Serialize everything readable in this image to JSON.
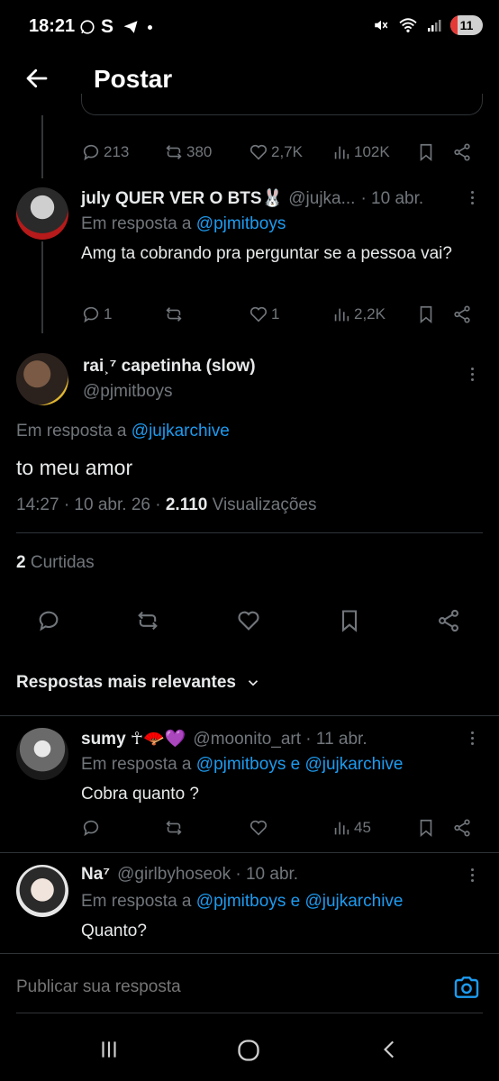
{
  "status_bar": {
    "time": "18:21",
    "app_icons": "S",
    "battery": "11"
  },
  "header": {
    "title": "Postar"
  },
  "parent_actions": {
    "replies": "213",
    "reposts": "380",
    "likes": "2,7K",
    "views": "102K"
  },
  "reply_july": {
    "name": "july QUER VER O BTS🐰",
    "handle": "@jujka...",
    "date": "· 10 abr.",
    "reply_prefix": "Em resposta a",
    "reply_to": "@pjmitboys",
    "text": "Amg ta cobrando pra perguntar se a pessoa vai?",
    "replies": "1",
    "likes": "1",
    "views": "2,2K"
  },
  "main_tweet": {
    "name": "rai˲⁷ capetinha (slow)",
    "handle": "@pjmitboys",
    "reply_prefix": "Em resposta a",
    "reply_to": "@jujkarchive",
    "text": "to meu amor",
    "time": "14:27 · 10 abr. 26 ·",
    "views_count": "2.110",
    "views_label": "Visualizações",
    "likes_count": "2",
    "likes_label": "Curtidas"
  },
  "sort": {
    "label": "Respostas mais relevantes"
  },
  "reply_sumy": {
    "name": "sumy ☥🪭💜",
    "handle_date": "@moonito_art · 11 abr.",
    "reply_prefix": "Em resposta a",
    "reply_to": "@pjmitboys e @jujkarchive",
    "text": "Cobra quanto ?",
    "views": "45"
  },
  "reply_na": {
    "name": "Na⁷",
    "handle_date": "@girlbyhoseok · 10 abr.",
    "reply_prefix": "Em resposta a",
    "reply_to": "@pjmitboys e @jujkarchive",
    "text": "Quanto?"
  },
  "composer": {
    "placeholder": "Publicar sua resposta"
  },
  "colors": {
    "background": "#000000",
    "link": "#1d9bf0",
    "muted": "#71767b",
    "text": "#e7e9ea",
    "divider": "#2f3336"
  }
}
